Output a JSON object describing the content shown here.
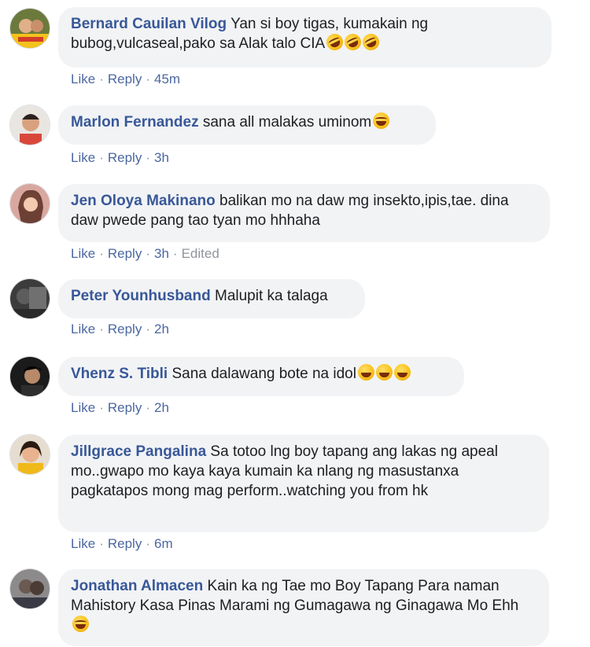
{
  "labels": {
    "like": "Like",
    "reply": "Reply",
    "dot": "·"
  },
  "colors": {
    "author": "#385898",
    "bubble": "#f2f3f5",
    "action": "#4b67a1",
    "meta": "#90949c"
  },
  "comments": [
    {
      "author": "Bernard Cauilan Vilog",
      "text": "Yan si boy tigas, kumakain ng bubog,vulcaseal,pako sa Alak talo CIA",
      "emoji": "rolling-on-floor-laughing ×3",
      "time": "45m",
      "edited": ""
    },
    {
      "author": "Marlon Fernandez",
      "text": "sana all malakas uminom",
      "emoji": "tears-of-joy",
      "time": "3h",
      "edited": ""
    },
    {
      "author": "Jen Oloya Makinano",
      "text": "balikan mo na daw mg insekto,ipis,tae. dina daw pwede pang tao tyan mo hhhaha",
      "emoji": "",
      "time": "3h",
      "edited": "Edited"
    },
    {
      "author": "Peter Younhusband",
      "text": "Malupit ka talaga",
      "emoji": "",
      "time": "2h",
      "edited": ""
    },
    {
      "author": "Vhenz S. Tibli",
      "text": "Sana dalawang bote na idol",
      "emoji": "grinning ×3",
      "time": "2h",
      "edited": ""
    },
    {
      "author": "Jillgrace Pangalina",
      "text": "Sa totoo lng boy tapang ang lakas ng apeal mo..gwapo mo kaya kaya kumain ka nlang ng masustanxa pagkatapos mong mag perform..watching you from hk",
      "emoji": "",
      "time": "6m",
      "edited": ""
    },
    {
      "author": "Jonathan Almacen",
      "text": "Kain ka ng Tae mo Boy Tapang Para naman Mahistory Kasa Pinas Marami ng Gumagawa ng Ginagawa Mo Ehh",
      "emoji": "tears-of-joy",
      "time": "",
      "edited": ""
    }
  ]
}
